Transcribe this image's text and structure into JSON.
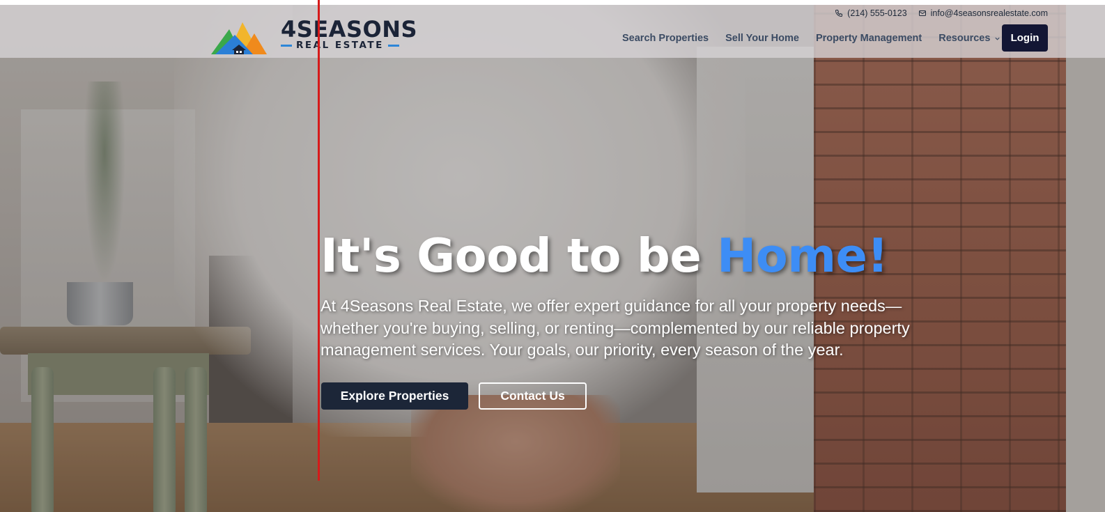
{
  "header": {
    "logo": {
      "number": "4",
      "word": "SEASONS",
      "subword": "REAL ESTATE"
    },
    "contact": {
      "phone": "(214) 555-0123",
      "email": "info@4seasonsrealestate.com",
      "phone_icon": "phone-icon",
      "email_icon": "mail-icon"
    },
    "nav": [
      {
        "label": "Search Properties"
      },
      {
        "label": "Sell Your Home"
      },
      {
        "label": "Property Management"
      },
      {
        "label": "Resources",
        "has_dropdown": true
      }
    ],
    "login_label": "Login"
  },
  "hero": {
    "headline_main": "It's Good to be ",
    "headline_accent": "Home!",
    "subtext": "At 4Seasons Real Estate, we offer expert guidance for all your property needs—whether you're buying, selling, or renting—complemented by our reliable property management services. Your goals, our priority, every season of the year.",
    "primary_button": "Explore Properties",
    "secondary_button": "Contact Us"
  },
  "colors": {
    "accent_blue": "#3d8df5",
    "login_bg": "#131634",
    "primary_button_bg": "#1c2638",
    "nav_text": "#3b4b63"
  }
}
